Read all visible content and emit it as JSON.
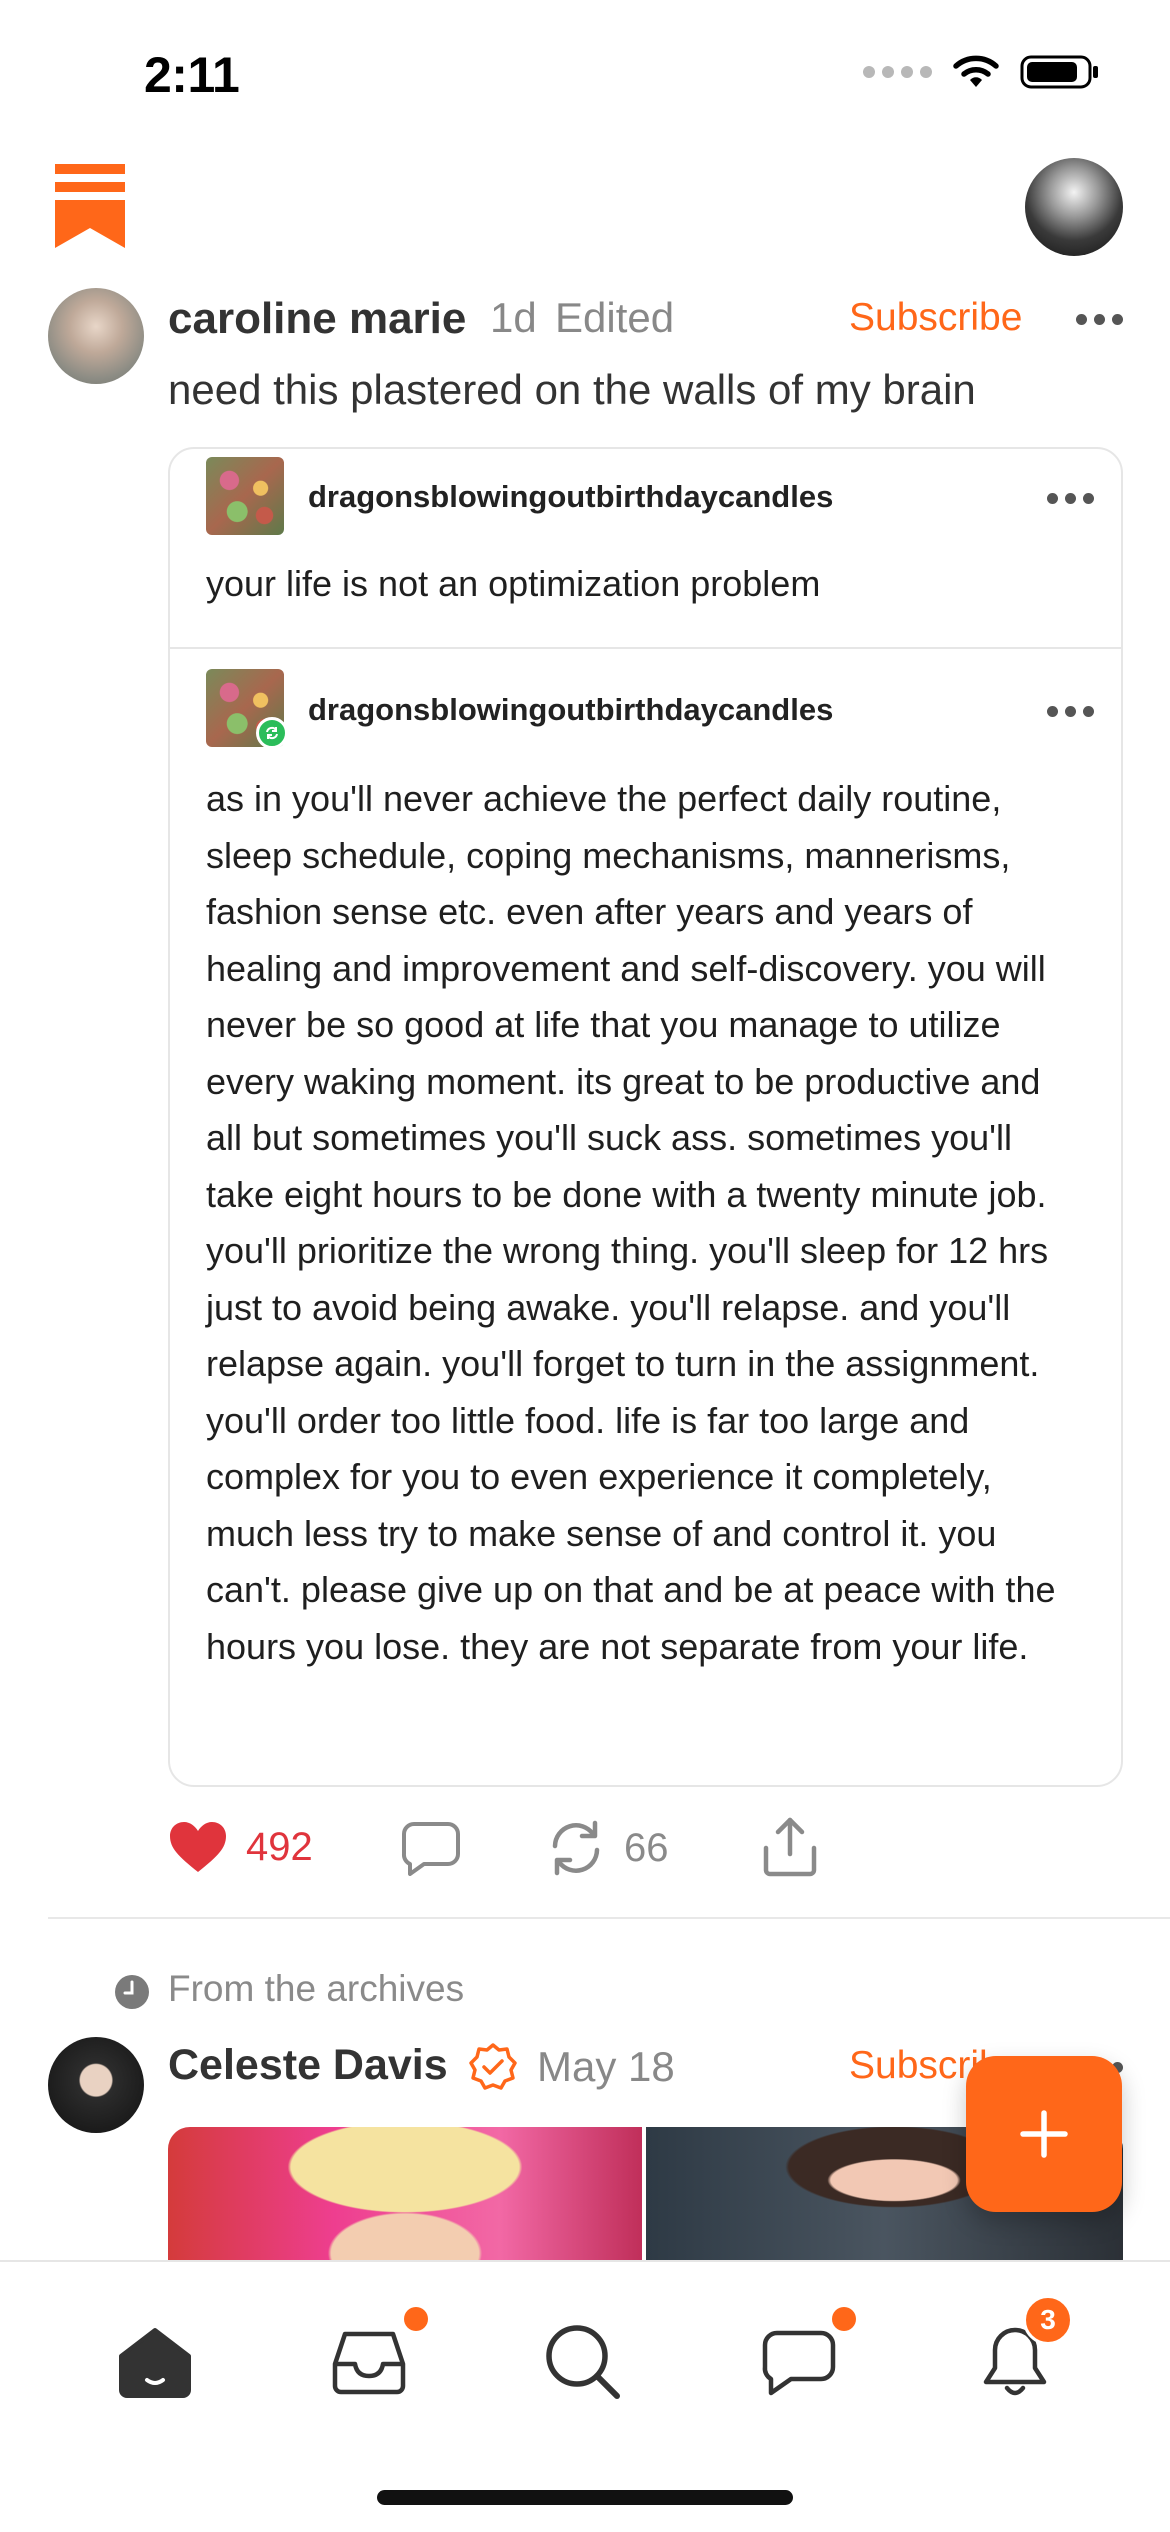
{
  "status_bar": {
    "time": "2:11"
  },
  "post": {
    "author": "caroline marie",
    "time_ago": "1d",
    "edited_label": "Edited",
    "subscribe_label": "Subscribe",
    "text": "need this plastered on the walls of my brain",
    "quoted_notes": [
      {
        "username": "dragonsblowingoutbirthdaycandles",
        "text": "your life is not an optimization problem"
      },
      {
        "username": "dragonsblowingoutbirthdaycandles",
        "text": "as in you'll never achieve the perfect daily routine, sleep schedule, coping mechanisms, mannerisms, fashion sense etc. even after years and years of healing and improvement and self-discovery. you will never be so good at life that you manage to utilize every waking moment. its great to be productive and all but sometimes you'll suck ass. sometimes you'll take eight hours to be done with a twenty minute job. you'll prioritize the wrong thing. you'll sleep for 12 hrs just to avoid being awake. you'll relapse. and you'll relapse again. you'll forget to turn in the assignment. you'll order too little food. life is far too large and complex for you to even experience it completely, much less try to make sense of and control it. you can't. please give up on that and be at peace with the hours you lose. they are not separate from your life."
      }
    ],
    "likes": "492",
    "restacks": "66"
  },
  "archive": {
    "label": "From the archives",
    "author": "Celeste Davis",
    "date": "May 18",
    "subscribe_label": "Subscribe"
  },
  "nav": {
    "items": [
      "home-icon",
      "inbox-icon",
      "search-icon",
      "chat-icon",
      "notifications-icon"
    ],
    "notification_count": "3"
  },
  "colors": {
    "accent": "#ff6719",
    "like": "#e0343c",
    "restack_badge": "#2bbd5a"
  }
}
